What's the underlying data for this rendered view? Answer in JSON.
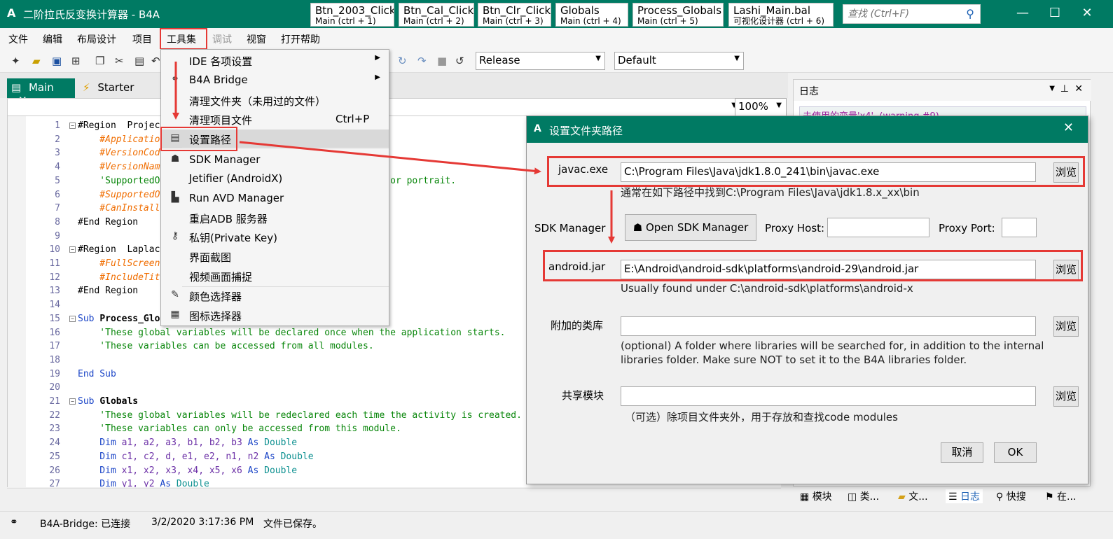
{
  "app": {
    "logo": "A",
    "title": "二阶拉氏反变换计算器 - B4A"
  },
  "title_tabs": [
    {
      "name": "Btn_2003_Click",
      "sub": "Main  (ctrl + 1)"
    },
    {
      "name": "Btn_Cal_Click",
      "sub": "Main  (ctrl + 2)"
    },
    {
      "name": "Btn_Clr_Click",
      "sub": "Main  (ctrl + 3)"
    },
    {
      "name": "Globals",
      "sub": "Main  (ctrl + 4)"
    },
    {
      "name": "Process_Globals",
      "sub": "Main  (ctrl + 5)"
    },
    {
      "name": "Lashi_Main.bal",
      "sub": "可视化设计器  (ctrl + 6)"
    }
  ],
  "search": {
    "placeholder": "查找 (Ctrl+F)"
  },
  "menu": [
    "文件",
    "编辑",
    "布局设计",
    "项目",
    "工具集",
    "调试",
    "视窗",
    "打开帮助"
  ],
  "toolbar": {
    "build_config": "Release",
    "device": "Default"
  },
  "doc_tabs": {
    "main": "Main",
    "starter": "Starter"
  },
  "zoom": "100%",
  "code_lines": [
    {
      "n": "1",
      "fold": "-",
      "parts": [
        [
          "",
          "#Region  Projec"
        ]
      ]
    },
    {
      "n": "2",
      "parts": [
        [
          "at",
          "    #Applicatio"
        ]
      ]
    },
    {
      "n": "3",
      "parts": [
        [
          "at",
          "    #VersionCod"
        ]
      ]
    },
    {
      "n": "4",
      "parts": [
        [
          "at",
          "    #VersionNam"
        ]
      ]
    },
    {
      "n": "5",
      "parts": [
        [
          "cm",
          "    'SupportedO"
        ],
        [
          "cm",
          "                                landscape or portrait."
        ]
      ]
    },
    {
      "n": "6",
      "parts": [
        [
          "at",
          "    #SupportedO"
        ]
      ]
    },
    {
      "n": "7",
      "parts": [
        [
          "at",
          "    #CanInstall"
        ]
      ]
    },
    {
      "n": "8",
      "parts": [
        [
          "",
          "#End Region"
        ]
      ]
    },
    {
      "n": "9",
      "parts": []
    },
    {
      "n": "10",
      "fold": "-",
      "parts": [
        [
          "",
          "#Region  Laplac"
        ]
      ]
    },
    {
      "n": "11",
      "parts": [
        [
          "at",
          "    #FullScreen"
        ]
      ]
    },
    {
      "n": "12",
      "parts": [
        [
          "at",
          "    #IncludeTit"
        ]
      ]
    },
    {
      "n": "13",
      "parts": [
        [
          "",
          "#End Region"
        ]
      ]
    },
    {
      "n": "14",
      "parts": []
    },
    {
      "n": "15",
      "fold": "-",
      "parts": [
        [
          "kw",
          "Sub "
        ],
        [
          "bd",
          "Process_Glo"
        ]
      ]
    },
    {
      "n": "16",
      "parts": [
        [
          "cm",
          "    'These global variables will be declared once when the application starts."
        ]
      ]
    },
    {
      "n": "17",
      "parts": [
        [
          "cm",
          "    'These variables can be accessed from all modules."
        ]
      ]
    },
    {
      "n": "18",
      "parts": []
    },
    {
      "n": "19",
      "parts": [
        [
          "kw",
          "End Sub"
        ]
      ]
    },
    {
      "n": "20",
      "parts": []
    },
    {
      "n": "21",
      "fold": "-",
      "parts": [
        [
          "kw",
          "Sub "
        ],
        [
          "bd",
          "Globals"
        ]
      ]
    },
    {
      "n": "22",
      "parts": [
        [
          "cm",
          "    'These global variables will be redeclared each time the activity is created."
        ]
      ]
    },
    {
      "n": "23",
      "parts": [
        [
          "cm",
          "    'These variables can only be accessed from this module."
        ]
      ]
    },
    {
      "n": "24",
      "parts": [
        [
          "kw",
          "    Dim "
        ],
        [
          "vr",
          "a1, a2, a3, b1, b2, b3 "
        ],
        [
          "kw",
          "As "
        ],
        [
          "ty",
          "Double"
        ]
      ]
    },
    {
      "n": "25",
      "parts": [
        [
          "kw",
          "    Dim "
        ],
        [
          "vr",
          "c1, c2, d, e1, e2, n1, n2 "
        ],
        [
          "kw",
          "As "
        ],
        [
          "ty",
          "Double"
        ]
      ]
    },
    {
      "n": "26",
      "parts": [
        [
          "kw",
          "    Dim "
        ],
        [
          "vr",
          "x1, x2, x3, x4, x5, x6 "
        ],
        [
          "kw",
          "As "
        ],
        [
          "ty",
          "Double"
        ]
      ]
    },
    {
      "n": "27",
      "parts": [
        [
          "kw",
          "    Dim "
        ],
        [
          "vr",
          "y1, y2 "
        ],
        [
          "kw",
          "As "
        ],
        [
          "ty",
          "Double"
        ]
      ]
    }
  ],
  "dropdown": [
    {
      "icon": "",
      "label": "IDE 各项设置",
      "shortcut": "",
      "submenu": true
    },
    {
      "icon": "⚭",
      "label": "B4A Bridge",
      "shortcut": "",
      "submenu": true
    },
    {
      "icon": "",
      "label": "清理文件夹（未用过的文件）",
      "shortcut": "",
      "submenu": false
    },
    {
      "icon": "",
      "label": "清理项目文件",
      "shortcut": "Ctrl+P",
      "submenu": false
    },
    {
      "icon": "▤",
      "label": "设置路径",
      "shortcut": "",
      "submenu": false
    },
    {
      "icon": "☗",
      "label": "SDK Manager",
      "shortcut": "",
      "submenu": false
    },
    {
      "icon": "",
      "label": "Jetifier (AndroidX)",
      "shortcut": "",
      "submenu": false
    },
    {
      "icon": "▙",
      "label": "Run AVD Manager",
      "shortcut": "",
      "submenu": false
    },
    {
      "icon": "",
      "label": "重启ADB 服务器",
      "shortcut": "",
      "submenu": false
    },
    {
      "icon": "⚷",
      "label": "私钥(Private Key)",
      "shortcut": "",
      "submenu": false
    },
    {
      "icon": "",
      "label": "界面截图",
      "shortcut": "",
      "submenu": false
    },
    {
      "icon": "",
      "label": "视频画面捕捉",
      "shortcut": "",
      "submenu": false
    },
    {
      "icon": "✎",
      "label": "颜色选择器",
      "shortcut": "",
      "submenu": false
    },
    {
      "icon": "▦",
      "label": "图标选择器",
      "shortcut": "",
      "submenu": false
    }
  ],
  "log_panel": {
    "title": "日志",
    "entry": "未使用的变量'x4'. (warning #9)"
  },
  "bottom_tabs": [
    "模块",
    "类...",
    "文...",
    "日志",
    "快搜",
    "在..."
  ],
  "status": {
    "bridge": "B4A-Bridge: 已连接",
    "time": "3/2/2020 3:17:36 PM",
    "saved": "文件已保存。"
  },
  "dialog": {
    "logo": "A",
    "title": "设置文件夹路径",
    "javac_label": "javac.exe",
    "javac_value": "C:\\Program Files\\Java\\jdk1.8.0_241\\bin\\javac.exe",
    "javac_hint": "通常在如下路径中找到C:\\Program Files\\Java\\jdk1.8.x_xx\\bin",
    "sdk_label": "SDK Manager",
    "open_sdk": "Open SDK Manager",
    "proxy_host": "Proxy Host:",
    "proxy_port": "Proxy Port:",
    "android_label": "android.jar",
    "android_value": "E:\\Android\\android-sdk\\platforms\\android-29\\android.jar",
    "android_hint": "Usually found under C:\\android-sdk\\platforms\\android-x",
    "libs_label": "附加的类库",
    "libs_hint_1": "(optional) A folder where libraries will be searched for, in addition to the internal",
    "libs_hint_2": "libraries folder. Make sure NOT to set it to the B4A libraries folder.",
    "shared_label": "共享模块",
    "shared_hint": "（可选）除项目文件夹外，用于存放和查找code modules",
    "browse": "浏览",
    "cancel": "取消",
    "ok": "OK"
  },
  "colors": {
    "accent": "#007a63",
    "highlight": "#e53935"
  }
}
